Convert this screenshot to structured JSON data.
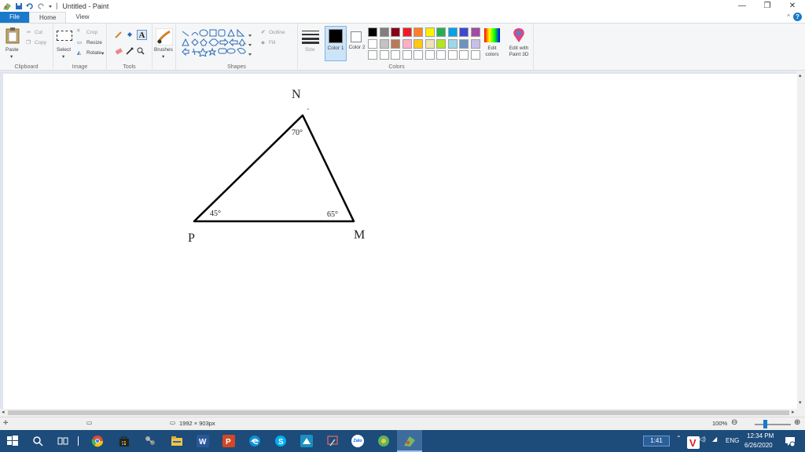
{
  "window": {
    "title": "Untitled - Paint",
    "qat_separator": "|",
    "minimize": "—",
    "maximize": "❐",
    "close": "✕"
  },
  "tabs": {
    "file": "File",
    "home": "Home",
    "view": "View",
    "help": "?",
    "collapse": "^"
  },
  "ribbon": {
    "clipboard": {
      "label": "Clipboard",
      "paste": "Paste",
      "cut": "Cut",
      "copy": "Copy"
    },
    "image": {
      "label": "Image",
      "select": "Select",
      "crop": "Crop",
      "resize": "Resize",
      "rotate": "Rotate"
    },
    "tools": {
      "label": "Tools",
      "text_tool": "A"
    },
    "brushes": {
      "label": "Brushes"
    },
    "shapes": {
      "label": "Shapes",
      "outline": "Outline",
      "fill": "Fill"
    },
    "size": {
      "label": "Size"
    },
    "colors": {
      "label": "Colors",
      "color1": "Color 1",
      "color2": "Color 2",
      "edit_colors": "Edit colors",
      "edit_paint3d": "Edit with Paint 3D",
      "color1_value": "#000000",
      "color2_value": "#ffffff",
      "palette_row1": [
        "#000000",
        "#7f7f7f",
        "#880015",
        "#ed1c24",
        "#ff7f27",
        "#fff200",
        "#22b14c",
        "#00a2e8",
        "#3f48cc",
        "#a349a4"
      ],
      "palette_row2": [
        "#ffffff",
        "#c3c3c3",
        "#b97a57",
        "#ffaec9",
        "#ffc90e",
        "#efe4b0",
        "#b5e61d",
        "#99d9ea",
        "#7092be",
        "#c8bfe7"
      ]
    }
  },
  "drawing": {
    "vertex_n": "N",
    "vertex_p": "P",
    "vertex_m": "M",
    "angle_n": "70°",
    "angle_p": "45°",
    "angle_m": "65°"
  },
  "status": {
    "canvas_size": "1992 × 903px",
    "zoom": "100%"
  },
  "taskbar": {
    "zalo": "Zalo",
    "time_badge": "1:41",
    "lang": "ENG",
    "time": "12:34 PM",
    "date": "6/26/2020"
  }
}
